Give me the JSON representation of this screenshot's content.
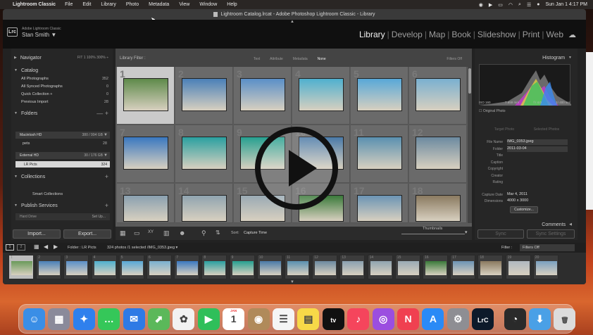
{
  "menubar": {
    "app_name": "Lightroom Classic",
    "items": [
      "File",
      "Edit",
      "Library",
      "Photo",
      "Metadata",
      "View",
      "Window",
      "Help"
    ],
    "datetime": "Sun Jan 1  4:17 PM"
  },
  "window": {
    "title": "Lightroom Catalog.lrcat - Adobe Photoshop Lightroom Classic - Library"
  },
  "identity": {
    "logo": "Lrc",
    "product": "Adobe Lightroom Classic",
    "user": "Stan Smith ▼"
  },
  "modules": [
    "Library",
    "Develop",
    "Map",
    "Book",
    "Slideshow",
    "Print",
    "Web"
  ],
  "active_module": "Library",
  "left_panel": {
    "navigator": {
      "title": "Navigator",
      "zoom": "FIT  1   100%   300%  ÷"
    },
    "catalog": {
      "title": "Catalog",
      "rows": [
        {
          "label": "All Photographs",
          "count": "352"
        },
        {
          "label": "All Synced Photographs",
          "count": "0"
        },
        {
          "label": "Quick Collection +",
          "count": "0"
        },
        {
          "label": "Previous Import",
          "count": "28"
        }
      ]
    },
    "folders": {
      "title": "Folders",
      "drives": [
        {
          "label": "Macintosh HD",
          "count": "380 / 994 GB"
        },
        {
          "label": "External HD",
          "count": "30 / 176 GB"
        }
      ],
      "sub_row": {
        "label": "pets",
        "count": "28"
      },
      "selected_folder": {
        "label": "LR Picts",
        "count": "324"
      }
    },
    "collections": {
      "title": "Collections",
      "smart": "Smart Collections"
    },
    "publish": {
      "title": "Publish Services",
      "hard_drive": "Hard Drive",
      "setup": "Set Up..."
    },
    "import_label": "Import...",
    "export_label": "Export..."
  },
  "filter_bar": {
    "label": "Library Filter :",
    "options": [
      "Text",
      "Attribute",
      "Metadata",
      "None"
    ],
    "selected": "None",
    "filters_off": "Filters Off"
  },
  "grid": {
    "cells": [
      {
        "num": "1",
        "color": "#5e8a4a",
        "selected": true
      },
      {
        "num": "2",
        "color": "#4a80b8"
      },
      {
        "num": "3",
        "color": "#5a8fc8"
      },
      {
        "num": "4",
        "color": "#4fb0cf"
      },
      {
        "num": "5",
        "color": "#58a8d8"
      },
      {
        "num": "6",
        "color": "#7ab0d0"
      },
      {
        "num": "7",
        "color": "#3a78c0"
      },
      {
        "num": "8",
        "color": "#2aa0a0"
      },
      {
        "num": "9",
        "color": "#26a090"
      },
      {
        "num": "10",
        "color": "#4a7aa8"
      },
      {
        "num": "11",
        "color": "#5a90b0"
      },
      {
        "num": "12",
        "color": "#6c8aa0"
      },
      {
        "num": "13",
        "color": "#8aa0b0"
      },
      {
        "num": "14",
        "color": "#90a4b0"
      },
      {
        "num": "15",
        "color": "#9aaab4"
      },
      {
        "num": "16",
        "color": "#3a7a3a"
      },
      {
        "num": "17",
        "color": "#6c94b4"
      },
      {
        "num": "18",
        "color": "#8a7a60"
      }
    ]
  },
  "toolbar": {
    "sort_label": "Sort:",
    "sort_value": "Capture Time",
    "thumbnails": "Thumbnails"
  },
  "right_panel": {
    "histogram_title": "Histogram",
    "exif": [
      "ISO 160",
      "7.659 mm",
      "f / 4.0",
      "1/ 400 sec"
    ],
    "original_photo": "Original Photo",
    "preset_tabs": [
      "Target Photo",
      "Selected Photos"
    ],
    "metadata": [
      {
        "label": "File Name",
        "value": "IMG_0353.jpeg",
        "box": true
      },
      {
        "label": "Folder",
        "value": "2011-03-04",
        "box": true
      },
      {
        "label": "Title",
        "value": "",
        "box": false
      },
      {
        "label": "Caption",
        "value": "",
        "box": false
      },
      {
        "label": "Copyright",
        "value": "",
        "box": false
      },
      {
        "label": "Creator",
        "value": "",
        "box": false
      },
      {
        "label": "Rating",
        "value": "",
        "box": false
      },
      {
        "label": "Capture Date",
        "value": "Mar 4, 2011",
        "box": false
      },
      {
        "label": "Dimensions",
        "value": "4000 x 3000",
        "box": false
      }
    ],
    "customize": "Customize...",
    "comments": "Comments",
    "sync": "Sync",
    "sync_settings": "Sync Settings"
  },
  "filmstrip_bar": {
    "pages": [
      "1",
      "2"
    ],
    "folder": "Folder : LR Picts",
    "status": "324 photos /1 selected /IMG_0353.jpeg ▾",
    "filter_label": "Filter :",
    "filter_value": "Filters Off"
  },
  "filmstrip": {
    "thumbs": [
      "#6a9a5a",
      "#4a80b8",
      "#5a8fc8",
      "#4fb0cf",
      "#58a8d8",
      "#7ab0d0",
      "#3a78c0",
      "#2aa0a0",
      "#26a090",
      "#4a7aa8",
      "#5a90b0",
      "#6c8aa0",
      "#8aa0b0",
      "#90a4b0",
      "#9aaab4",
      "#3a7a3a",
      "#6c94b4",
      "#8a7a60",
      "#b0b8c0",
      "#7aa0c0"
    ],
    "numbers": [
      "1",
      "2",
      "3",
      "4",
      "5",
      "6",
      "7",
      "8",
      "9",
      "10",
      "11",
      "12",
      "13",
      "14",
      "15",
      "16",
      "17",
      "18",
      "19",
      "20"
    ]
  },
  "dock": {
    "apps": [
      {
        "name": "Finder",
        "color": "#3a8ee6",
        "glyph": "☺"
      },
      {
        "name": "Launchpad",
        "color": "#8a8a9a",
        "glyph": "▦"
      },
      {
        "name": "Safari",
        "color": "#2f80ed",
        "glyph": "✦"
      },
      {
        "name": "Messages",
        "color": "#35c759",
        "glyph": "…"
      },
      {
        "name": "Mail",
        "color": "#2f7ae5",
        "glyph": "✉"
      },
      {
        "name": "Maps",
        "color": "#5bb85a",
        "glyph": "⬈"
      },
      {
        "name": "Photos",
        "color": "#f2f2f2",
        "glyph": "✿"
      },
      {
        "name": "FaceTime",
        "color": "#2fbf5a",
        "glyph": "▶"
      },
      {
        "name": "Calendar",
        "color": "#ffffff",
        "glyph": "1"
      },
      {
        "name": "Contacts",
        "color": "#b08a5a",
        "glyph": "◉"
      },
      {
        "name": "Reminders",
        "color": "#f5f5f5",
        "glyph": "☰"
      },
      {
        "name": "Notes",
        "color": "#f7d948",
        "glyph": "▤"
      },
      {
        "name": "Apple TV",
        "color": "#111111",
        "glyph": "tv"
      },
      {
        "name": "Music",
        "color": "#f5455c",
        "glyph": "♪"
      },
      {
        "name": "Podcasts",
        "color": "#9b4ee0",
        "glyph": "◎"
      },
      {
        "name": "News",
        "color": "#f04050",
        "glyph": "N"
      },
      {
        "name": "App Store",
        "color": "#2a8af6",
        "glyph": "A"
      },
      {
        "name": "System Settings",
        "color": "#8e8e93",
        "glyph": "⚙"
      },
      {
        "name": "Lightroom Classic",
        "color": "#0d1a2a",
        "glyph": "LrC"
      },
      {
        "name": "QuickTime",
        "color": "#2a2a2a",
        "glyph": "◔"
      },
      {
        "name": "Downloads",
        "color": "#4aa0e6",
        "glyph": "⬇"
      },
      {
        "name": "Trash",
        "color": "#dcdcdc",
        "glyph": "🗑"
      }
    ]
  },
  "calendar_month": "JAN",
  "colors": {
    "accent": "#f2f2f2",
    "panel": "#262626",
    "grid_bg": "#5a5a5a"
  }
}
